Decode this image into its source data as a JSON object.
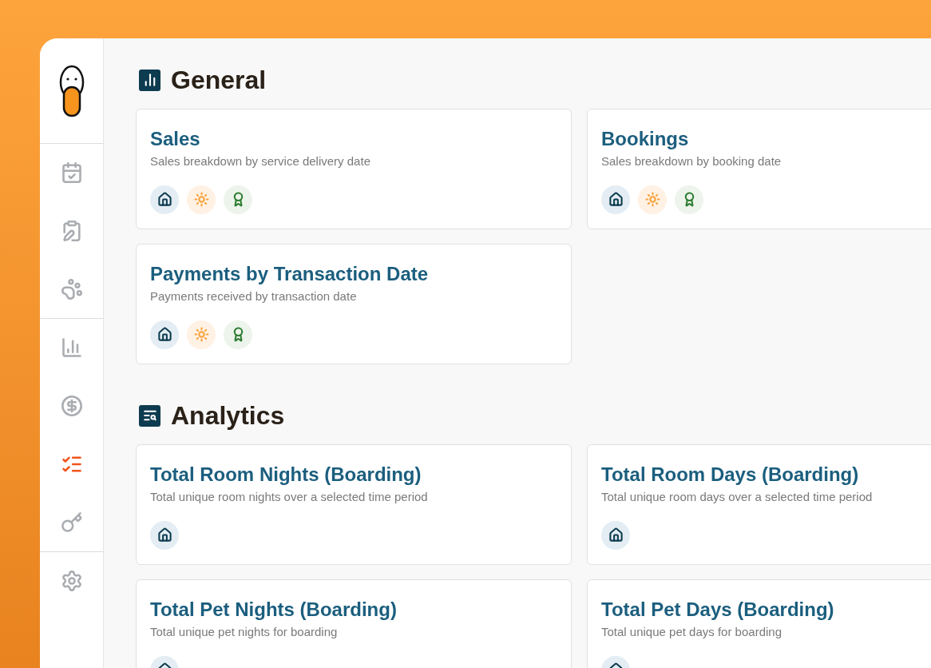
{
  "sidebar": {
    "groups": [
      {
        "items": [
          {
            "selected": false
          },
          {
            "selected": false
          },
          {
            "selected": false
          }
        ]
      },
      {
        "items": [
          {
            "selected": false
          },
          {
            "selected": false
          },
          {
            "selected": true
          },
          {
            "selected": false
          }
        ]
      },
      {
        "items": [
          {
            "selected": false
          }
        ]
      }
    ]
  },
  "sections": [
    {
      "title": "General",
      "cards": [
        {
          "title": "Sales",
          "description": "Sales breakdown by service delivery date",
          "services": [
            {
              "kind": "boarding"
            },
            {
              "kind": "daycare"
            },
            {
              "kind": "training"
            }
          ]
        },
        {
          "title": "Bookings",
          "description": "Sales breakdown by booking date",
          "services": [
            {
              "kind": "boarding"
            },
            {
              "kind": "daycare"
            },
            {
              "kind": "training"
            }
          ]
        },
        {
          "title": "Payments by Transaction Date",
          "description": "Payments received by transaction date",
          "services": [
            {
              "kind": "boarding"
            },
            {
              "kind": "daycare"
            },
            {
              "kind": "training"
            }
          ]
        }
      ]
    },
    {
      "title": "Analytics",
      "cards": [
        {
          "title": "Total Room Nights (Boarding)",
          "description": "Total unique room nights over a selected time period",
          "services": [
            {
              "kind": "boarding"
            }
          ]
        },
        {
          "title": "Total Room Days (Boarding)",
          "description": "Total unique room days over a selected time period",
          "services": [
            {
              "kind": "boarding"
            }
          ]
        },
        {
          "title": "Total Pet Nights (Boarding)",
          "description": "Total unique pet nights for boarding",
          "services": [
            {
              "kind": "boarding"
            }
          ]
        },
        {
          "title": "Total Pet Days (Boarding)",
          "description": "Total unique pet days for boarding",
          "services": [
            {
              "kind": "boarding"
            }
          ]
        }
      ]
    }
  ]
}
